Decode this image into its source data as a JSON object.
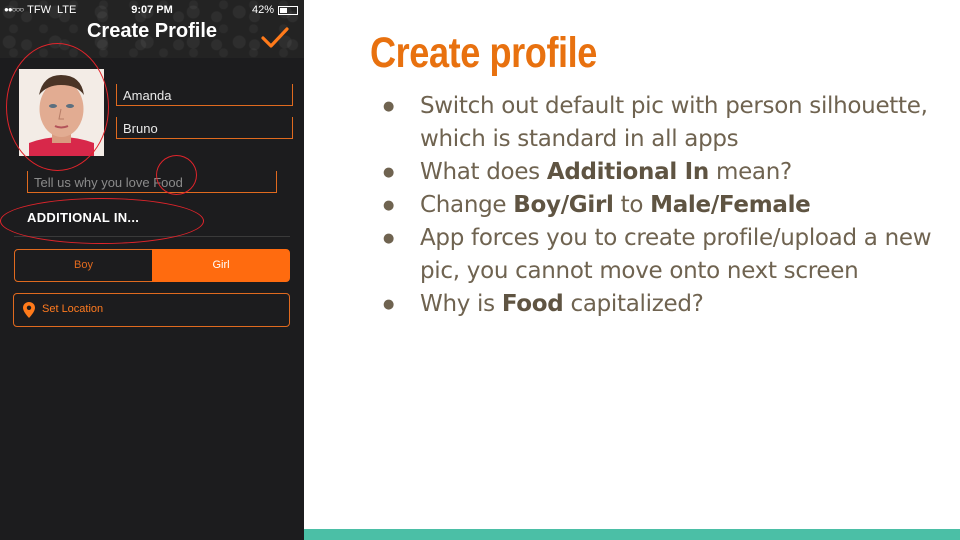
{
  "status_bar": {
    "signal": "●●○○○",
    "carrier": "TFW",
    "network": "LTE",
    "time": "9:07 PM",
    "battery": "42%",
    "battery_level": 0.42
  },
  "header": {
    "title": "Create Profile",
    "confirm_icon": "checkmark-icon"
  },
  "form": {
    "first_name": "Amanda",
    "last_name": "Bruno",
    "love_placeholder": "Tell us why you love Food",
    "additional_label": "ADDITIONAL IN...",
    "gender_options": [
      "Boy",
      "Girl"
    ],
    "gender_selected": "Girl",
    "location_label": "Set Location",
    "location_icon": "location-pin-icon"
  },
  "slide": {
    "title": "Create profile",
    "bullets": [
      {
        "parts": [
          "Switch out default pic with person silhouette, which is standard in all apps"
        ]
      },
      {
        "parts": [
          "What does ",
          "Additional In",
          " mean?"
        ]
      },
      {
        "parts": [
          "Change ",
          "Boy/Girl",
          " to ",
          "Male/Female"
        ]
      },
      {
        "parts": [
          "App forces you to create profile/upload a new pic, you cannot move onto next screen"
        ]
      },
      {
        "parts": [
          "Why is ",
          "Food",
          " capitalized?"
        ]
      }
    ]
  },
  "colors": {
    "accent": "#ff6b0f",
    "title_orange": "#e8710f",
    "annotation_red": "#e0242b",
    "footer_teal": "#4bbfa6",
    "text_brown": "#6f6350"
  }
}
